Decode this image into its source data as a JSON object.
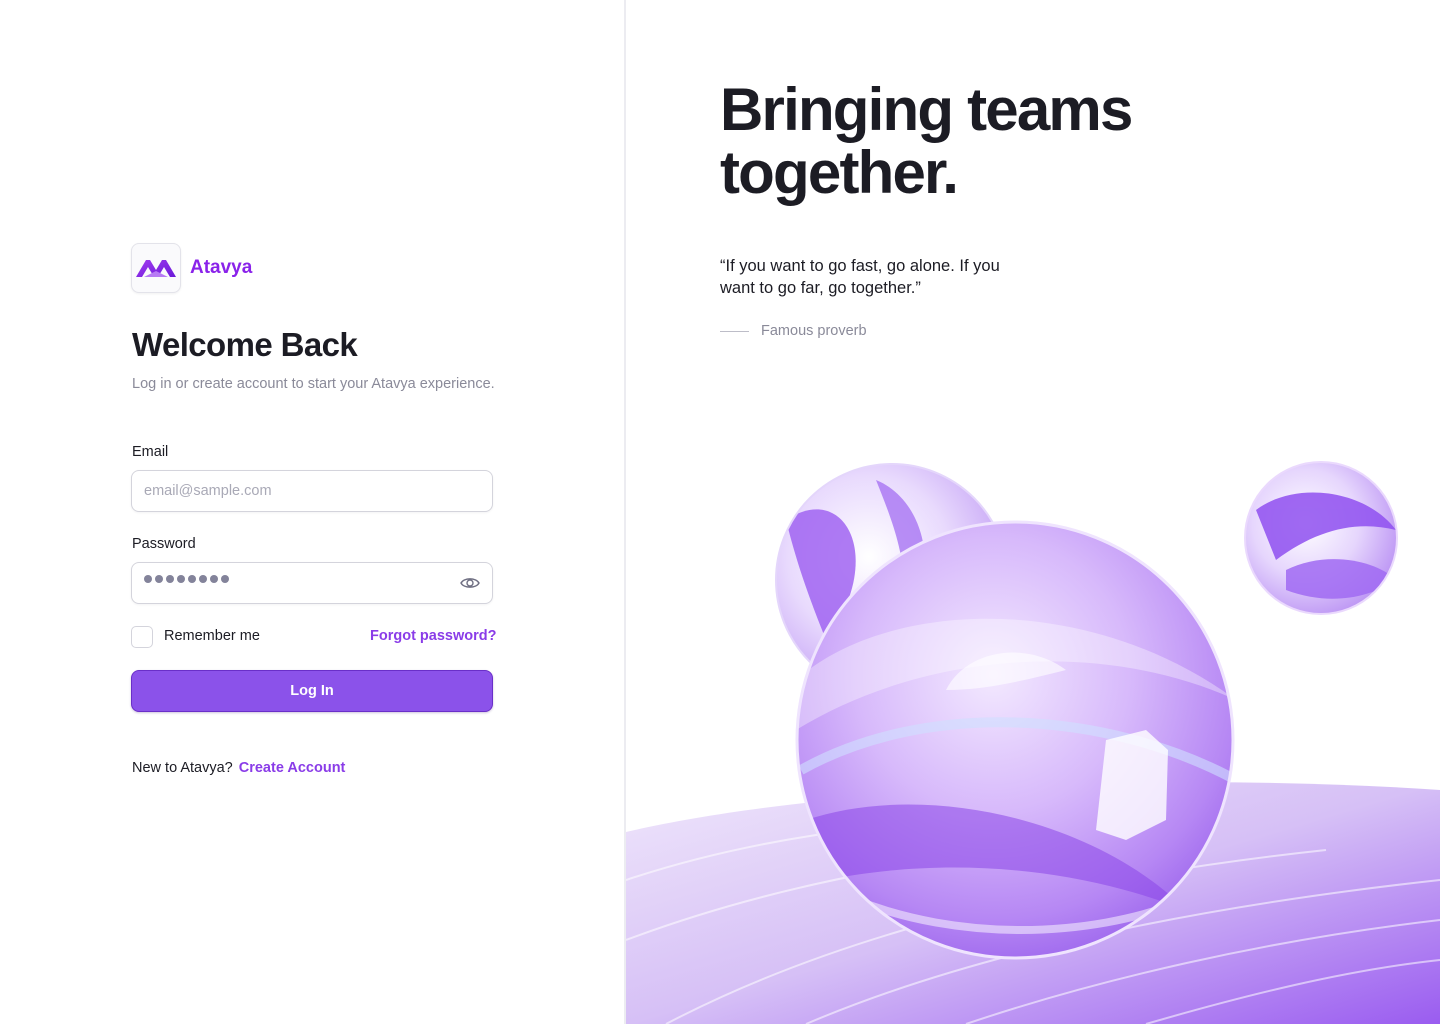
{
  "brand": {
    "name": "Atavya",
    "logo_icon": "atavya-logo-icon",
    "accent_color": "#8a22ea"
  },
  "login": {
    "title": "Welcome Back",
    "subtitle": "Log in or create account to start your Atavya experience.",
    "email": {
      "label": "Email",
      "placeholder": "email@sample.com",
      "value": ""
    },
    "password": {
      "label": "Password",
      "masked_length": 8,
      "toggle_icon": "eye-icon"
    },
    "remember_label": "Remember me",
    "remember_checked": false,
    "forgot_label": "Forgot password?",
    "submit_label": "Log In",
    "signup_prompt": "New to Atavya?",
    "signup_link": "Create Account",
    "button_color": "#8b52ea"
  },
  "hero": {
    "headline_line1": "Bringing teams",
    "headline_line2": "together.",
    "quote": "“If you want to go fast, go alone. If you want to go far, go together.”",
    "attribution": "Famous proverb",
    "illustration": "purple-glass-spheres"
  }
}
